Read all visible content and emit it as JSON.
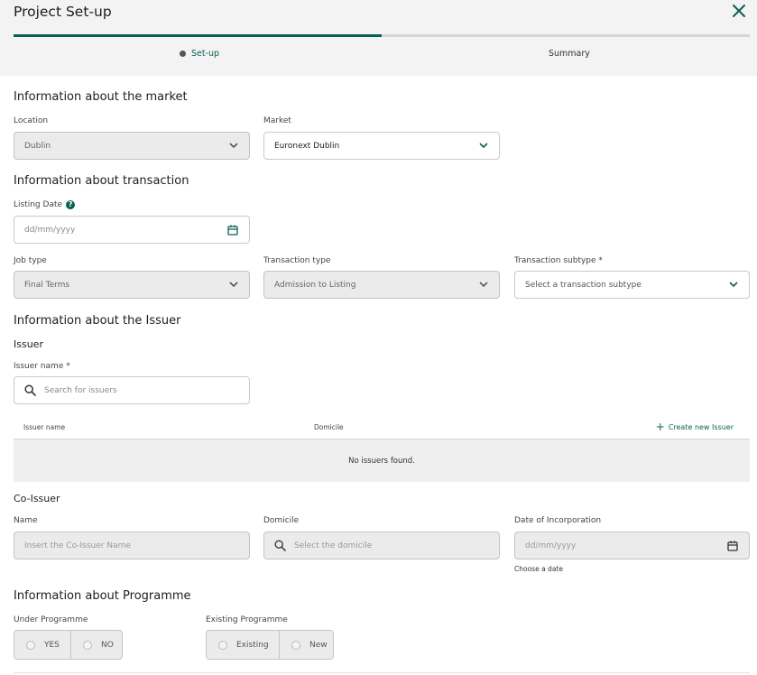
{
  "header": {
    "title": "Project Set-up",
    "progress_fraction": 0.5,
    "steps": [
      {
        "label": "Set-up",
        "active": true
      },
      {
        "label": "Summary",
        "active": false
      }
    ]
  },
  "market": {
    "title": "Information about the market",
    "location_label": "Location",
    "location_value": "Dublin",
    "market_label": "Market",
    "market_value": "Euronext Dublin"
  },
  "transaction": {
    "title": "Information about transaction",
    "listing_date_label": "Listing Date",
    "listing_date_placeholder": "dd/mm/yyyy",
    "job_type_label": "Job type",
    "job_type_value": "Final Terms",
    "transaction_type_label": "Transaction type",
    "transaction_type_value": "Admission to Listing",
    "transaction_subtype_label": "Transaction subtype *",
    "transaction_subtype_placeholder": "Select a transaction subtype"
  },
  "issuer": {
    "title": "Information about the Issuer",
    "subtitle": "Issuer",
    "name_label": "Issuer name *",
    "search_placeholder": "Search for issuers",
    "table": {
      "columns": [
        "Issuer name",
        "Domicile"
      ],
      "create_label": "Create new Issuer",
      "empty_text": "No issuers found."
    }
  },
  "co_issuer": {
    "subtitle": "Co-Issuer",
    "name_label": "Name",
    "name_placeholder": "Insert the Co-Issuer Name",
    "domicile_label": "Domicile",
    "domicile_placeholder": "Select the domicile",
    "incorporation_label": "Date of Incorporation",
    "incorporation_placeholder": "dd/mm/yyyy",
    "incorporation_hint": "Choose a date"
  },
  "programme": {
    "title": "Information about Programme",
    "under_label": "Under Programme",
    "under_options": [
      "YES",
      "NO"
    ],
    "existing_label": "Existing Programme",
    "existing_options": [
      "Existing",
      "New"
    ]
  },
  "colors": {
    "accent": "#0b5f53",
    "disabled_bg": "#ebebeb",
    "header_bg": "#f3f3f3"
  },
  "icons": {
    "close": "close-icon",
    "chevron": "chevron-down-icon",
    "calendar": "calendar-icon",
    "search": "search-icon",
    "help": "help-icon",
    "plus": "plus-icon"
  }
}
